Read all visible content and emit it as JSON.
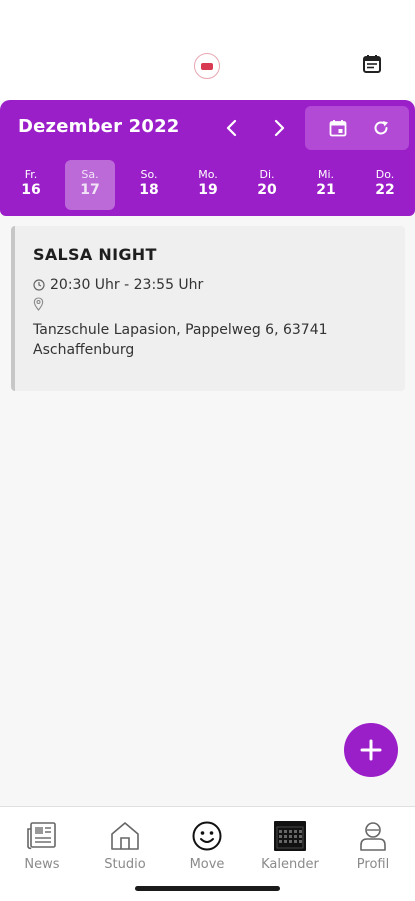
{
  "header": {
    "logo": "studio-logo",
    "calendar_icon": "calendar-list-icon"
  },
  "calendar_bar": {
    "month_title": "Dezember 2022",
    "prev_icon": "chevron-left-icon",
    "next_icon": "chevron-right-icon",
    "today_icon": "calendar-today-icon",
    "refresh_icon": "refresh-icon",
    "days": [
      {
        "name": "Fr.",
        "num": "16",
        "selected": false
      },
      {
        "name": "Sa.",
        "num": "17",
        "selected": true
      },
      {
        "name": "So.",
        "num": "18",
        "selected": false
      },
      {
        "name": "Mo.",
        "num": "19",
        "selected": false
      },
      {
        "name": "Di.",
        "num": "20",
        "selected": false
      },
      {
        "name": "Mi.",
        "num": "21",
        "selected": false
      },
      {
        "name": "Do.",
        "num": "22",
        "selected": false
      }
    ]
  },
  "event": {
    "title": "SALSA NIGHT",
    "time": "20:30  Uhr - 23:55  Uhr",
    "location": "Tanzschule Lapasion, Pappelweg 6, 63741 Aschaffenburg",
    "clock_icon": "clock-icon",
    "pin_icon": "location-pin-icon"
  },
  "fab": {
    "icon": "plus-icon"
  },
  "bottom_nav": {
    "tabs": [
      {
        "label": "News",
        "icon": "news-icon"
      },
      {
        "label": "Studio",
        "icon": "house-icon"
      },
      {
        "label": "Move",
        "icon": "smiley-icon"
      },
      {
        "label": "Kalender",
        "icon": "calendar-grid-icon",
        "active": true
      },
      {
        "label": "Profil",
        "icon": "person-icon"
      }
    ]
  },
  "colors": {
    "accent": "#9b1fc9",
    "selected_day": "#bd6ad9",
    "card_bg": "#efefef"
  }
}
